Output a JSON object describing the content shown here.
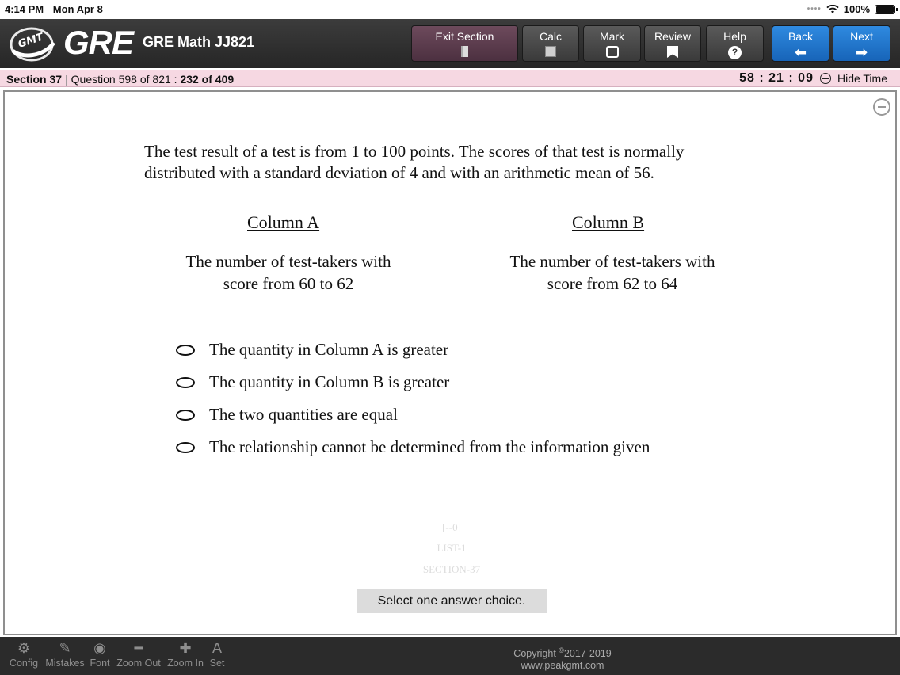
{
  "status_bar": {
    "time": "4:14 PM",
    "date": "Mon Apr 8",
    "battery": "100%",
    "icons": [
      "wifi-icon",
      "battery-icon"
    ]
  },
  "header": {
    "logo_text": "GMT",
    "brand": "GRE",
    "title": "GRE Math JJ821",
    "buttons": {
      "exit_section": "Exit Section",
      "calc": "Calc",
      "mark": "Mark",
      "review": "Review",
      "help": "Help",
      "back": "Back",
      "next": "Next"
    },
    "colors": {
      "exit": "#5d3d4e",
      "nav_blue": "#1f78d1",
      "toolbar_dark": "#333333"
    }
  },
  "info_bar": {
    "section": "Section 37",
    "question": "Question 598 of 821 :",
    "position": "232 of 409",
    "timer": "58 : 21 : 09",
    "hide_time": "Hide Time",
    "background": "#f6d8e2"
  },
  "question": {
    "stem": "The test result of a test is from 1 to 100 points. The scores of that test is normally distributed with a standard deviation of 4 and with an arithmetic mean of 56.",
    "column_a_header": "Column A",
    "column_b_header": "Column B",
    "column_a_line1": "The number of test-takers with",
    "column_a_line2": "score from 60 to 62",
    "column_b_line1": "The number of test-takers with",
    "column_b_line2": "score from 62 to 64",
    "choices": [
      "The quantity in Column A is greater",
      "The quantity in Column B is greater",
      "The two quantities are equal",
      "The relationship cannot be determined from the information given"
    ],
    "selected_choice": null,
    "faint_labels": [
      "[--0]",
      "LIST-1",
      "SECTION-37"
    ],
    "instruction": "Select one answer choice."
  },
  "bottom_bar": {
    "items": [
      {
        "label": "Config",
        "icon": "gear-icon"
      },
      {
        "label": "Mistakes",
        "icon": "edit-icon"
      },
      {
        "label": "Font",
        "icon": "font-icon"
      },
      {
        "label": "Zoom Out",
        "icon": "minus-icon"
      },
      {
        "label": "Zoom In",
        "icon": "plus-icon"
      },
      {
        "label": "Set",
        "icon": "text-settings-icon"
      }
    ],
    "copyright_prefix": "Copyright ",
    "copyright_symbol": "©",
    "copyright_years": "2017-2019",
    "website": "www.peakgmt.com"
  }
}
